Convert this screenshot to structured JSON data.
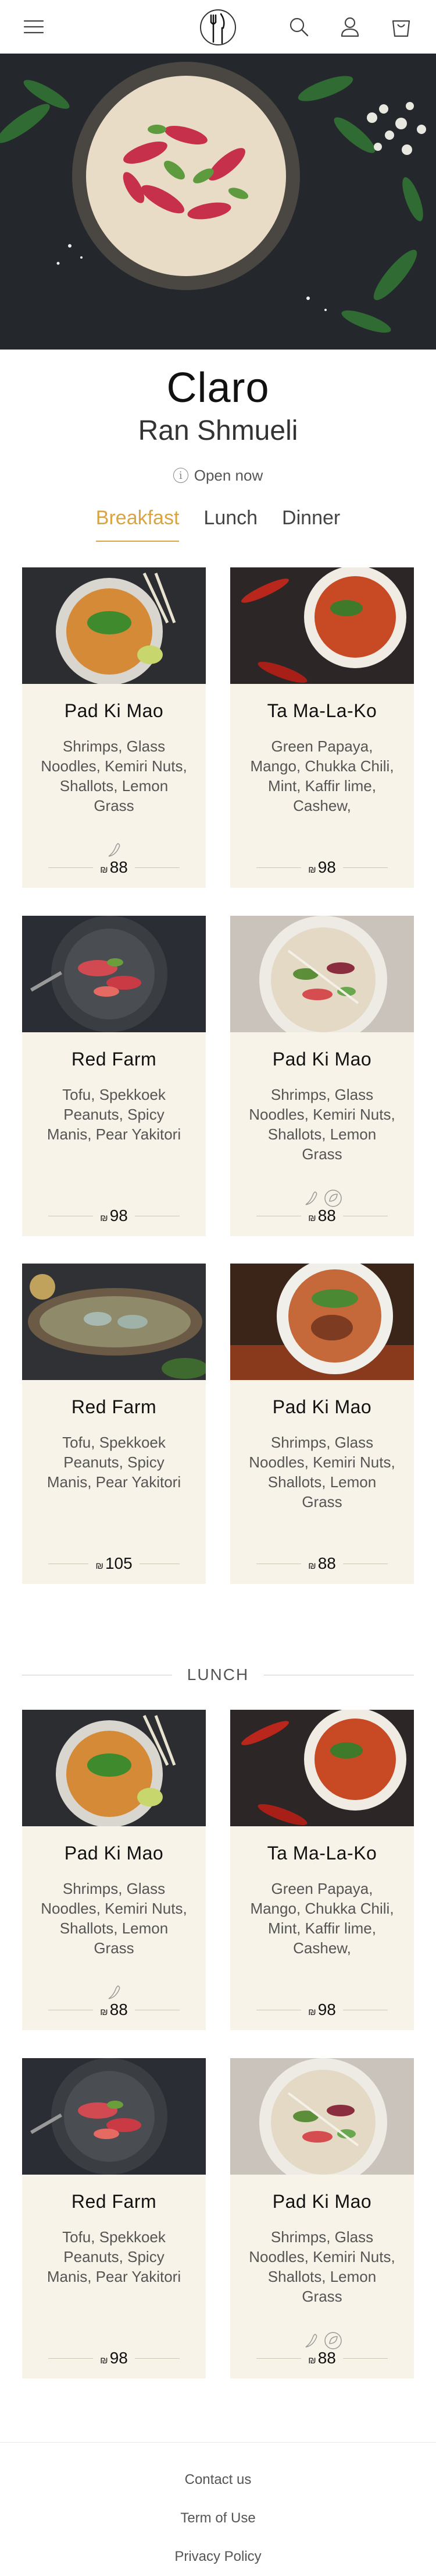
{
  "header": {
    "menu_icon": "hamburger-menu-icon",
    "logo_icon": "fork-knife-logo-icon",
    "search_icon": "search-icon",
    "account_icon": "user-icon",
    "cart_icon": "shopping-bag-icon"
  },
  "restaurant": {
    "name": "Claro",
    "chef": "Ran Shmueli",
    "status": "Open now"
  },
  "tabs": [
    {
      "label": "Breakfast",
      "active": true
    },
    {
      "label": "Lunch",
      "active": false
    },
    {
      "label": "Dinner",
      "active": false
    }
  ],
  "breakfast_items": [
    {
      "name": "Pad Ki Mao",
      "description": "Shrimps, Glass Noodles, Kemiri Nuts, Shallots, Lemon Grass",
      "currency": "₪",
      "price": "88",
      "tags": [
        "spicy"
      ]
    },
    {
      "name": "Ta Ma-La-Ko",
      "description": "Green Papaya, Mango, Chukka Chili, Mint, Kaffir lime, Cashew,",
      "currency": "₪",
      "price": "98",
      "tags": []
    },
    {
      "name": "Red Farm",
      "description": "Tofu, Spekkoek Peanuts, Spicy Manis, Pear Yakitori",
      "currency": "₪",
      "price": "98",
      "tags": []
    },
    {
      "name": "Pad Ki Mao",
      "description": "Shrimps, Glass Noodles, Kemiri Nuts, Shallots, Lemon Grass",
      "currency": "₪",
      "price": "88",
      "tags": [
        "spicy",
        "vegan"
      ]
    },
    {
      "name": "Red Farm",
      "description": "Tofu, Spekkoek Peanuts, Spicy Manis, Pear Yakitori",
      "currency": "₪",
      "price": "105",
      "tags": []
    },
    {
      "name": "Pad Ki Mao",
      "description": "Shrimps, Glass Noodles, Kemiri Nuts, Shallots, Lemon Grass",
      "currency": "₪",
      "price": "88",
      "tags": []
    }
  ],
  "lunch_section": {
    "title": "LUNCH"
  },
  "lunch_items": [
    {
      "name": "Pad Ki Mao",
      "description": "Shrimps, Glass Noodles, Kemiri Nuts, Shallots, Lemon Grass",
      "currency": "₪",
      "price": "88",
      "tags": [
        "spicy"
      ]
    },
    {
      "name": "Ta Ma-La-Ko",
      "description": "Green Papaya, Mango, Chukka Chili, Mint, Kaffir lime, Cashew,",
      "currency": "₪",
      "price": "98",
      "tags": []
    },
    {
      "name": "Red Farm",
      "description": "Tofu, Spekkoek Peanuts, Spicy Manis, Pear Yakitori",
      "currency": "₪",
      "price": "98",
      "tags": []
    },
    {
      "name": "Pad Ki Mao",
      "description": "Shrimps, Glass Noodles, Kemiri Nuts, Shallots, Lemon Grass",
      "currency": "₪",
      "price": "88",
      "tags": [
        "spicy",
        "vegan"
      ]
    }
  ],
  "footer": {
    "links": [
      "Contact us",
      "Term of Use",
      "Privacy Policy"
    ]
  },
  "colors": {
    "accent": "#d9a441",
    "card_bg": "#f8f3e8"
  }
}
